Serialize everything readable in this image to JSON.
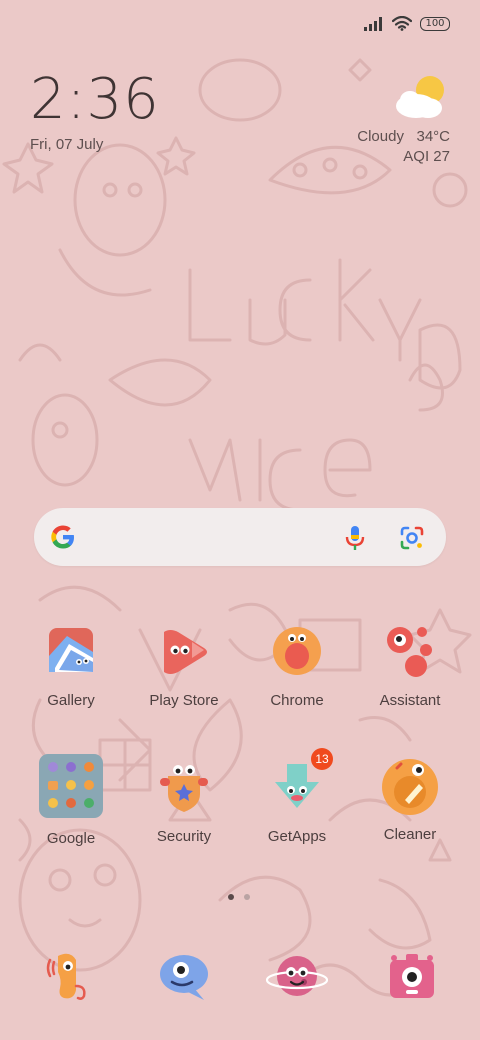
{
  "status_bar": {
    "battery": "100"
  },
  "clock": {
    "time": "2:36",
    "date": "Fri, 07 July"
  },
  "weather": {
    "condition": "Cloudy",
    "temperature": "34°C",
    "aqi": "AQI 27"
  },
  "apps": [
    {
      "label": "Gallery",
      "icon": "gallery-icon"
    },
    {
      "label": "Play Store",
      "icon": "play-store-icon"
    },
    {
      "label": "Chrome",
      "icon": "chrome-icon"
    },
    {
      "label": "Assistant",
      "icon": "assistant-icon"
    },
    {
      "label": "Google",
      "icon": "google-folder-icon"
    },
    {
      "label": "Security",
      "icon": "security-icon"
    },
    {
      "label": "GetApps",
      "icon": "getapps-icon",
      "badge": "13"
    },
    {
      "label": "Cleaner",
      "icon": "cleaner-icon"
    }
  ],
  "dock": [
    {
      "icon": "phone-icon"
    },
    {
      "icon": "messages-icon"
    },
    {
      "icon": "browser-icon"
    },
    {
      "icon": "camera-icon"
    }
  ],
  "colors": {
    "wallpaper": "#ebc9c8",
    "badge": "#f04a1e",
    "search_bar": "#f2eded"
  }
}
